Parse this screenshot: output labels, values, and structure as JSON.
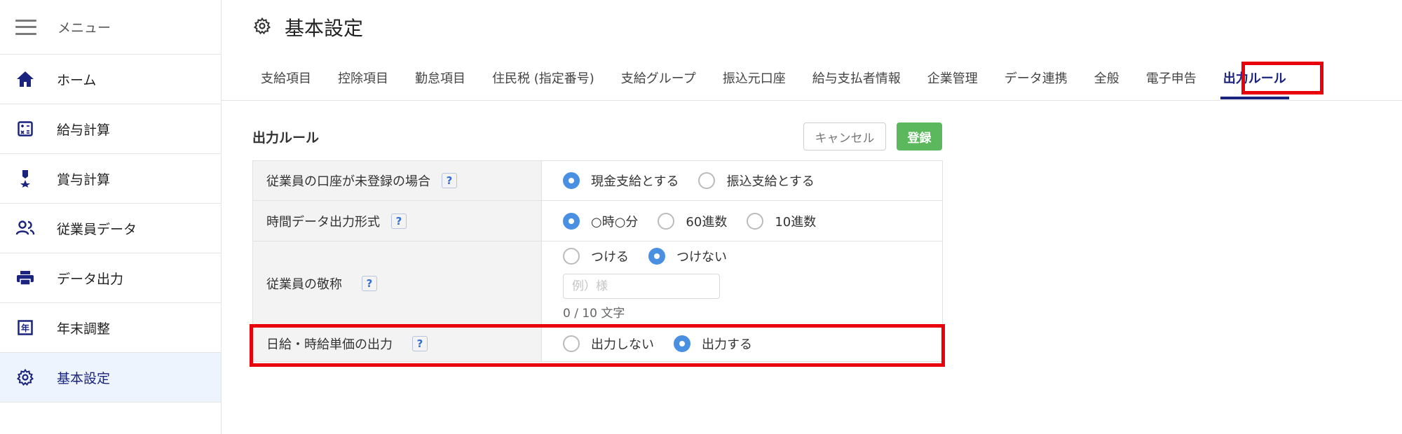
{
  "sidebar": {
    "menu_label": "メニュー",
    "items": [
      {
        "label": "ホーム",
        "icon": "home-icon"
      },
      {
        "label": "給与計算",
        "icon": "calculator-icon"
      },
      {
        "label": "賞与計算",
        "icon": "medal-icon"
      },
      {
        "label": "従業員データ",
        "icon": "people-icon"
      },
      {
        "label": "データ出力",
        "icon": "printer-icon"
      },
      {
        "label": "年末調整",
        "icon": "year-end-icon"
      },
      {
        "label": "基本設定",
        "icon": "gear-icon",
        "active": true
      }
    ]
  },
  "header": {
    "title": "基本設定",
    "icon": "gear-icon"
  },
  "tabs": [
    {
      "label": "支給項目"
    },
    {
      "label": "控除項目"
    },
    {
      "label": "勤怠項目"
    },
    {
      "label": "住民税 (指定番号)"
    },
    {
      "label": "支給グループ"
    },
    {
      "label": "振込元口座"
    },
    {
      "label": "給与支払者情報"
    },
    {
      "label": "企業管理"
    },
    {
      "label": "データ連携"
    },
    {
      "label": "全般"
    },
    {
      "label": "電子申告"
    },
    {
      "label": "出力ルール",
      "active": true
    }
  ],
  "panel": {
    "title": "出力ルール",
    "cancel_label": "キャンセル",
    "save_label": "登録",
    "rows": [
      {
        "label": "従業員の口座が未登録の場合",
        "help": "?",
        "options": [
          {
            "label": "現金支給とする",
            "selected": true
          },
          {
            "label": "振込支給とする",
            "selected": false
          }
        ]
      },
      {
        "label": "時間データ出力形式",
        "help": "?",
        "options": [
          {
            "label": "○時○分",
            "selected": true
          },
          {
            "label": "60進数",
            "selected": false
          },
          {
            "label": "10進数",
            "selected": false
          }
        ]
      },
      {
        "label": "従業員の敬称",
        "help": "?",
        "options": [
          {
            "label": "つける",
            "selected": false
          },
          {
            "label": "つけない",
            "selected": true
          }
        ],
        "input_value": "",
        "input_placeholder": "例）様",
        "counter": "0 / 10 文字"
      },
      {
        "label": "日給・時給単価の出力",
        "help": "?",
        "options": [
          {
            "label": "出力しない",
            "selected": false
          },
          {
            "label": "出力する",
            "selected": true
          }
        ]
      }
    ]
  },
  "colors": {
    "accent": "#1a237e",
    "radio_selected": "#4a90e2",
    "save_button": "#5cb85c",
    "highlight": "#e8000b",
    "active_nav_bg": "#eef4fd"
  }
}
